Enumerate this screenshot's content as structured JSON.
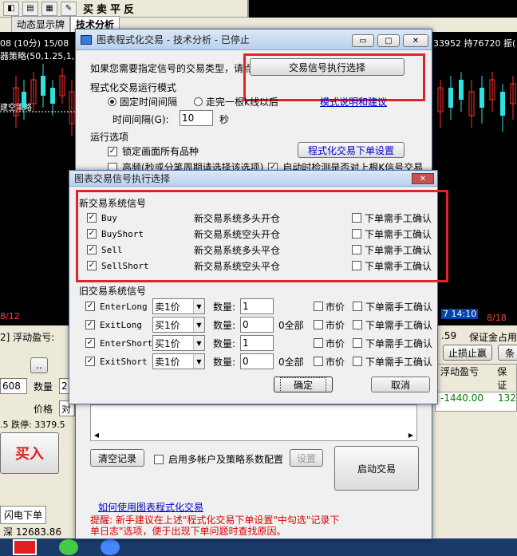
{
  "toolbar": {
    "items": [
      "买",
      "卖",
      "平",
      "反"
    ]
  },
  "tabs": {
    "dynamic": "动态显示牌",
    "tech": "技术分析"
  },
  "chart_bg": {
    "date_label": "08 (10分) 15/08",
    "strategy_label": "器策略(50,1.25,1,",
    "left_label": "建空策略",
    "date_bottom": "8/12",
    "right_top": "33952 持76720 振(",
    "right_bottom": "7 14:10",
    "right_date": "8/18"
  },
  "bottom_panel": {
    "float_label": "2]  浮动盈亏:",
    "price1": "608",
    "qty_label": "数量",
    "qty_val": "2",
    "price_label": "价格",
    "price_val": "对",
    "stat": ".5  跌停: 3379.5",
    "buy": "买入",
    "flash": "闪电下单",
    "depth": "深 12683.86",
    "rp_1": ".59",
    "rp_2": "保证金占用",
    "rp_stop": "止损止赢",
    "rp_3": "条",
    "col1": "浮动盈亏",
    "col2": "保证",
    "cell1": "-1440.00",
    "cell2": "132"
  },
  "main_dialog": {
    "title": "图表程式化交易 - 技术分析 - 已停止",
    "intro": "如果您需要指定信号的交易类型，请点击",
    "exec_btn": "交易信号执行选择",
    "mode_section": "程式化交易运行模式",
    "fixed_interval": "固定时间间隔",
    "complete": "走完一根k线以后",
    "mode_link": "模式说明和建议",
    "interval_label": "时间间隔(G):",
    "interval_val": "10",
    "sec": "秒",
    "run_section": "运行选项",
    "lock": "锁定画面所有品种",
    "order_settings": "程式化交易下单设置",
    "high_freq": "高频(秒或分笔周期请选择该选项)",
    "start_detect": "启动时检测是否对上根K信号交易",
    "clear": "清空记录",
    "multi": "启用多帐户及策略系数配置",
    "setup": "设置",
    "start": "启动交易",
    "help_link": "如何使用图表程式化交易",
    "tip": "提醒: 新手建议在上述\"程式化交易下单设置\"中勾选\"记录下单日志\"选项，便于出现下单问题时查找原因。"
  },
  "signal_dialog": {
    "title": "图表交易信号执行选择",
    "new_section": "新交易系统信号",
    "manual": "下单需手工确认",
    "new_signals": [
      {
        "name": "Buy",
        "desc": "新交易系统多头开仓"
      },
      {
        "name": "BuyShort",
        "desc": "新交易系统空头开仓"
      },
      {
        "name": "Sell",
        "desc": "新交易系统多头平仓"
      },
      {
        "name": "SellShort",
        "desc": "新交易系统空头平仓"
      }
    ],
    "old_section": "旧交易系统信号",
    "qty_label": "数量:",
    "all": "0全部",
    "market": "市价",
    "old_signals": [
      {
        "name": "EnterLong",
        "price": "卖1价",
        "qty": "1",
        "all": ""
      },
      {
        "name": "ExitLong",
        "price": "买1价",
        "qty": "0",
        "all": "0全部"
      },
      {
        "name": "EnterShort",
        "price": "买1价",
        "qty": "1",
        "all": ""
      },
      {
        "name": "ExitShort",
        "price": "卖1价",
        "qty": "0",
        "all": "0全部"
      }
    ],
    "ok": "确定",
    "cancel": "取消"
  },
  "colors": {
    "red_highlight": "#e0232a",
    "candle_red": "#ff3030",
    "candle_cyan": "#30e0e0"
  }
}
